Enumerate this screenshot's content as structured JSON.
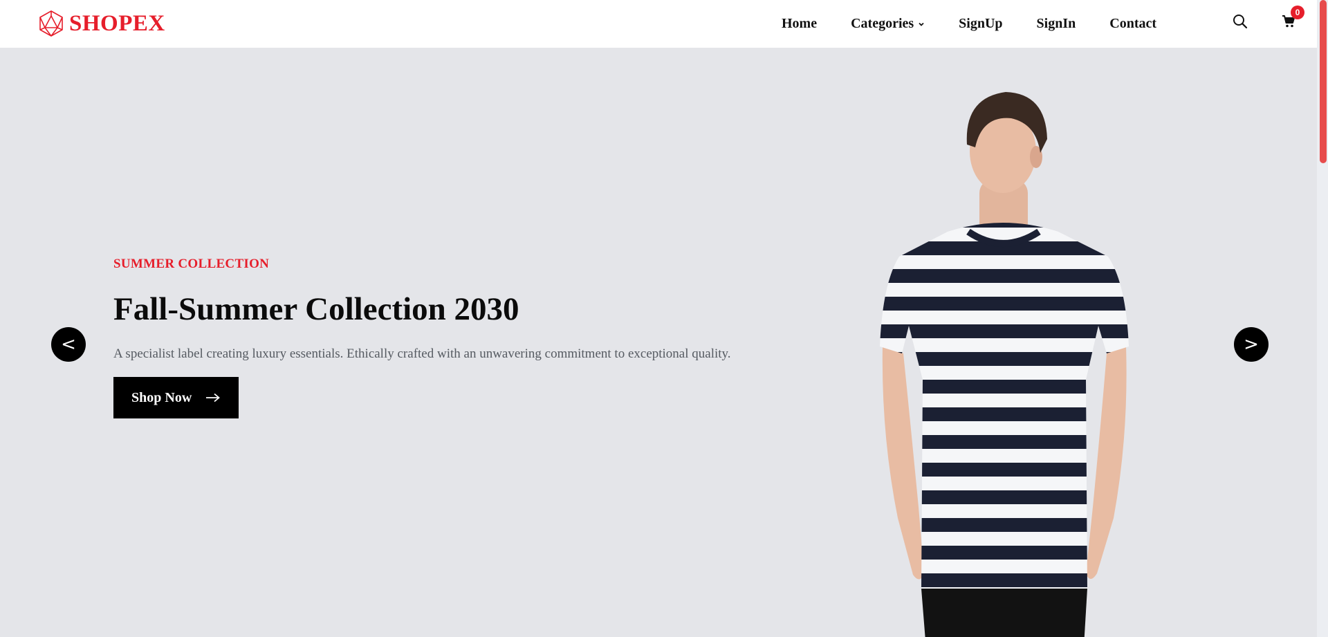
{
  "brand": {
    "name": "SHOPEX",
    "color": "#e61e2b"
  },
  "nav": {
    "items": [
      {
        "label": "Home",
        "has_dropdown": false
      },
      {
        "label": "Categories",
        "has_dropdown": true
      },
      {
        "label": "SignUp",
        "has_dropdown": false
      },
      {
        "label": "SignIn",
        "has_dropdown": false
      },
      {
        "label": "Contact",
        "has_dropdown": false
      }
    ],
    "search_icon": "search-icon",
    "cart_icon": "cart-icon",
    "cart_count": "0"
  },
  "hero": {
    "eyebrow": "SUMMER COLLECTION",
    "title": "Fall-Summer Collection 2030",
    "description": "A specialist label creating luxury essentials. Ethically crafted with an unwavering commitment to exceptional quality.",
    "cta_label": "Shop Now",
    "prev_label": "<",
    "next_label": ">",
    "background": "#e4e5e9"
  },
  "colors": {
    "accent": "#e61e2b",
    "text_dark": "#0b0b0b",
    "text_muted": "#555a61",
    "scroll_thumb": "#e74c4c"
  }
}
